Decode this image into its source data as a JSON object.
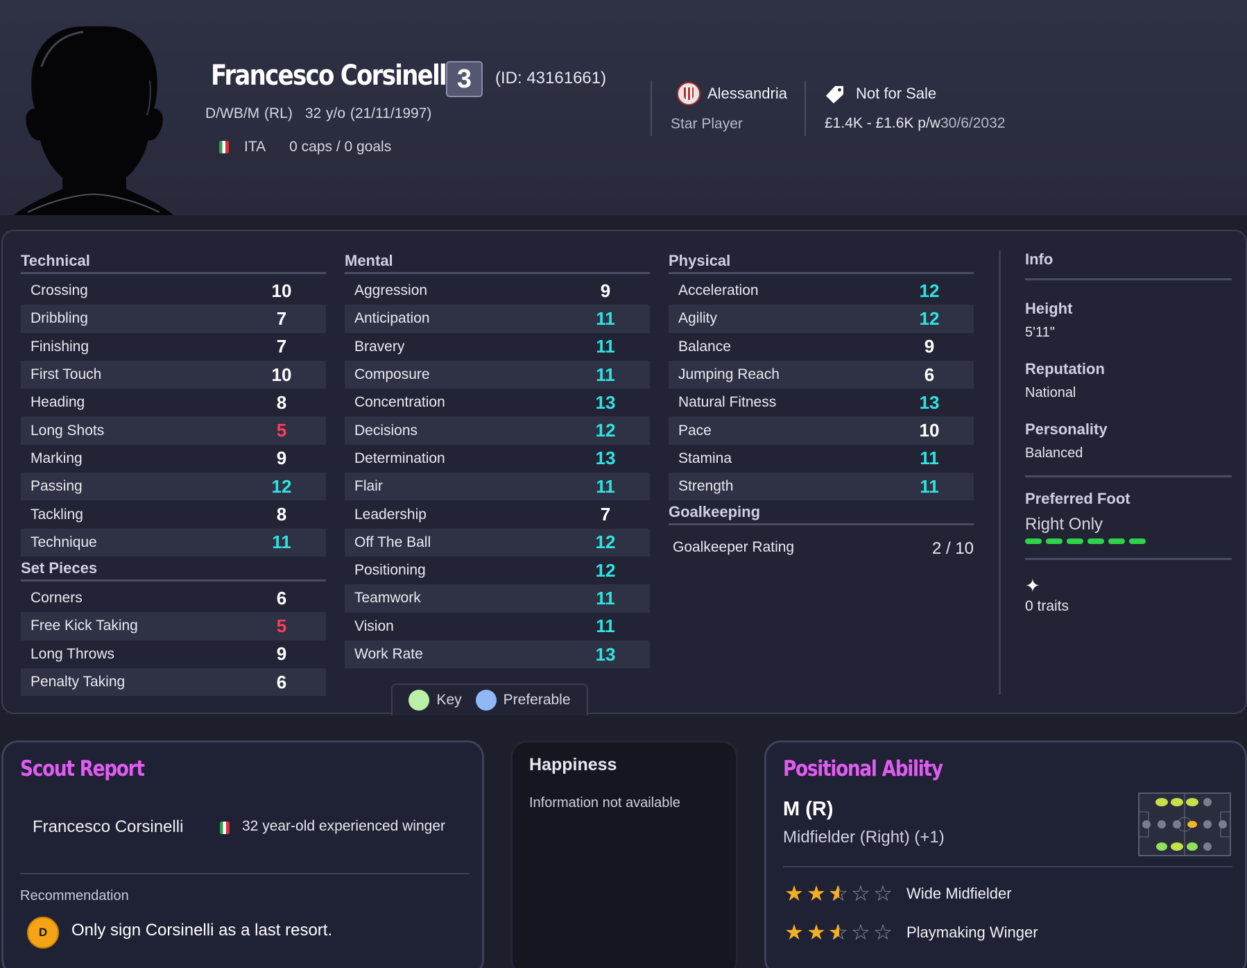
{
  "player": {
    "name": "Francesco Corsinelli",
    "shirt_number": "3",
    "id_text": "(ID: 43161661)",
    "positions": "D/WB/M (RL)",
    "age_dob": "32 y/o (21/11/1997)",
    "nationality": "ITA",
    "caps_goals": "0 caps / 0 goals"
  },
  "club": {
    "name": "Alessandria",
    "role": "Star Player"
  },
  "contract": {
    "transfer_status": "Not for Sale",
    "wage": "£1.4K - £1.6K p/w",
    "expiry": "30/6/2032"
  },
  "attributes": {
    "technical": {
      "title": "Technical",
      "items": [
        {
          "label": "Crossing",
          "value": "10"
        },
        {
          "label": "Dribbling",
          "value": "7"
        },
        {
          "label": "Finishing",
          "value": "7"
        },
        {
          "label": "First Touch",
          "value": "10"
        },
        {
          "label": "Heading",
          "value": "8"
        },
        {
          "label": "Long Shots",
          "value": "5"
        },
        {
          "label": "Marking",
          "value": "9"
        },
        {
          "label": "Passing",
          "value": "12"
        },
        {
          "label": "Tackling",
          "value": "8"
        },
        {
          "label": "Technique",
          "value": "11"
        }
      ]
    },
    "set_pieces": {
      "title": "Set Pieces",
      "items": [
        {
          "label": "Corners",
          "value": "6"
        },
        {
          "label": "Free Kick Taking",
          "value": "5"
        },
        {
          "label": "Long Throws",
          "value": "9"
        },
        {
          "label": "Penalty Taking",
          "value": "6"
        }
      ]
    },
    "mental": {
      "title": "Mental",
      "items": [
        {
          "label": "Aggression",
          "value": "9"
        },
        {
          "label": "Anticipation",
          "value": "11"
        },
        {
          "label": "Bravery",
          "value": "11"
        },
        {
          "label": "Composure",
          "value": "11"
        },
        {
          "label": "Concentration",
          "value": "13"
        },
        {
          "label": "Decisions",
          "value": "12"
        },
        {
          "label": "Determination",
          "value": "13"
        },
        {
          "label": "Flair",
          "value": "11"
        },
        {
          "label": "Leadership",
          "value": "7"
        },
        {
          "label": "Off The Ball",
          "value": "12"
        },
        {
          "label": "Positioning",
          "value": "12"
        },
        {
          "label": "Teamwork",
          "value": "11"
        },
        {
          "label": "Vision",
          "value": "11"
        },
        {
          "label": "Work Rate",
          "value": "13"
        }
      ]
    },
    "physical": {
      "title": "Physical",
      "items": [
        {
          "label": "Acceleration",
          "value": "12"
        },
        {
          "label": "Agility",
          "value": "12"
        },
        {
          "label": "Balance",
          "value": "9"
        },
        {
          "label": "Jumping Reach",
          "value": "6"
        },
        {
          "label": "Natural Fitness",
          "value": "13"
        },
        {
          "label": "Pace",
          "value": "10"
        },
        {
          "label": "Stamina",
          "value": "11"
        },
        {
          "label": "Strength",
          "value": "11"
        }
      ]
    },
    "goalkeeping": {
      "title": "Goalkeeping",
      "rating_label": "Goalkeeper Rating",
      "rating_value": "2 / 10"
    }
  },
  "value_colors": {
    "high": "#2ee5e1",
    "mid": "#ffffff",
    "low": "#ff3d5e"
  },
  "info": {
    "title": "Info",
    "height_label": "Height",
    "height_value": "5'11\"",
    "reputation_label": "Reputation",
    "reputation_value": "National",
    "personality_label": "Personality",
    "personality_value": "Balanced",
    "foot_label": "Preferred Foot",
    "foot_value": "Right Only",
    "foot_level": 1.0,
    "traits_icon": "sparkle-icon",
    "traits": "0 traits"
  },
  "legend": {
    "key_label": "Key",
    "key_color": "#b9f0a6",
    "preferable_label": "Preferable",
    "preferable_color": "#8fb8f5"
  },
  "scout_report": {
    "title": "Scout Report",
    "player_name": "Francesco Corsinelli",
    "summary": "32 year-old experienced winger",
    "recommendation_label": "Recommendation",
    "grade": "D",
    "recommendation": "Only sign Corsinelli as a last resort."
  },
  "happiness": {
    "title": "Happiness",
    "text": "Information not available"
  },
  "positional_ability": {
    "title": "Positional Ability",
    "position_code": "M (R)",
    "position_name": "Midfielder (Right) (+1)",
    "roles": [
      {
        "name": "Wide Midfielder",
        "stars": 2.5,
        "max": 5
      },
      {
        "name": "Playmaking Winger",
        "stars": 2.5,
        "max": 5
      }
    ]
  }
}
